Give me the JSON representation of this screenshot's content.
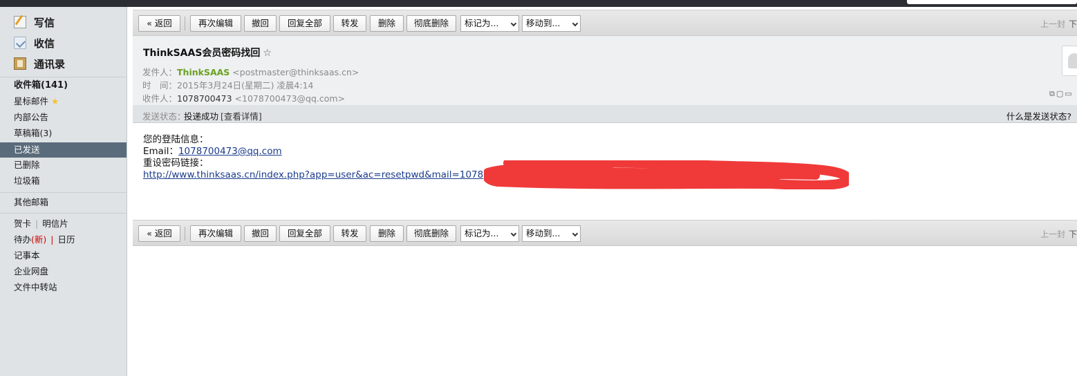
{
  "sidebar": {
    "compose": "写信",
    "receive": "收信",
    "contacts": "通讯录",
    "inbox": "收件箱(141)",
    "starred": "星标邮件",
    "announcements": "内部公告",
    "drafts": "草稿箱(3)",
    "sent": "已发送",
    "deleted": "已删除",
    "spam": "垃圾箱",
    "other_mailbox": "其他邮箱",
    "greeting_card": "贺卡",
    "postcard": "明信片",
    "todo": "待办",
    "todo_new": "(新)",
    "calendar": "日历",
    "notebook": "记事本",
    "enterprise_disk": "企业网盘",
    "file_transfer": "文件中转站"
  },
  "toolbar": {
    "back": "« 返回",
    "reedit": "再次编辑",
    "recall": "撤回",
    "reply_all": "回复全部",
    "forward": "转发",
    "delete": "删除",
    "delete_permanently": "彻底删除",
    "mark_as": "标记为...",
    "move_to": "移动到...",
    "prev": "上一封",
    "next": "下"
  },
  "email": {
    "subject": "ThinkSAAS会员密码找回",
    "favorite_icon": "☆",
    "from_label": "发件人：",
    "from_name": "ThinkSAAS",
    "from_address": "<postmaster@thinksaas.cn>",
    "time_label": "时　间：",
    "time_value": "2015年3月24日(星期二) 凌晨4:14",
    "to_label": "收件人：",
    "to_name": "1078700473",
    "to_address": "<1078700473@qq.com>",
    "status_label": "发送状态：",
    "status_value": "投递成功",
    "status_detail": "[查看详情]",
    "status_help": "什么是发送状态?",
    "body_line1": "您的登陆信息：",
    "body_email_label": "Email：",
    "body_email": "1078700473@qq.com",
    "body_line3": "重设密码链接：",
    "body_link": "http://www.thinksaas.cn/index.php?app=user&ac=resetpwd&mail=1078"
  },
  "colors": {
    "sidebar_bg": "#dfe3e6",
    "selected_bg": "#5a6b7b",
    "sender_green": "#6aa121",
    "link_blue": "#1a3b8c",
    "redaction_red": "#f03a3a"
  }
}
